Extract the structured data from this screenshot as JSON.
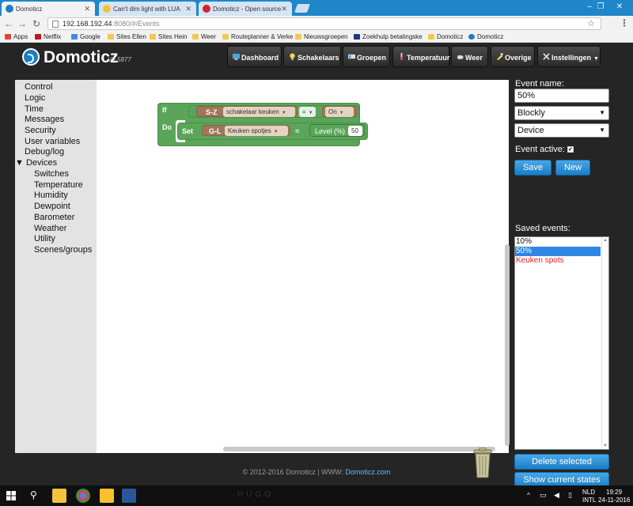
{
  "browser": {
    "tabs": [
      {
        "title": "Domoticz",
        "active": true
      },
      {
        "title": "Can't dim light with LUA",
        "active": false
      },
      {
        "title": "Domoticz - Open source",
        "active": false
      }
    ],
    "url_host": "192.168.192.44",
    "url_rest": ":8080/#/Events",
    "bookmarks": [
      "Apps",
      "Netflix",
      "Google",
      "Sites Ellen",
      "Sites Hein",
      "Weer",
      "Routeplanner & Verke",
      "Nieuwsgroepen",
      "Zoekhulp betalingske",
      "Domoticz",
      "Domoticz"
    ]
  },
  "app": {
    "name": "Domoticz",
    "version": "V3.5877",
    "nav": [
      "Dashboard",
      "Schakelaars",
      "Groepen",
      "Temperatuur",
      "Weer",
      "Overige",
      "Instellingen"
    ]
  },
  "sidebar": {
    "items": [
      "Control",
      "Logic",
      "Time",
      "Messages",
      "Security",
      "User variables",
      "Debug/log"
    ],
    "devices_toggle": "▼",
    "devices_label": "Devices",
    "subitems": [
      "Switches",
      "Temperature",
      "Humidity",
      "Dewpoint",
      "Barometer",
      "Weather",
      "Utility",
      "Scenes/groups"
    ]
  },
  "blocks": {
    "if_label": "If",
    "do_label": "Do",
    "cond_type": "S-Z",
    "cond_device": "schakelaar keuken",
    "cond_op": "=",
    "cond_value": "On",
    "set_label": "Set",
    "set_type": "G-L",
    "set_device": "Keuken spotjes",
    "set_eq": "=",
    "set_level_label": "Level (%)",
    "set_level_value": "50"
  },
  "panel": {
    "event_name_label": "Event name:",
    "event_name": "50%",
    "type_select": "Blockly",
    "trigger_select": "Device",
    "event_active_label": "Event active:",
    "event_active_check": "✔",
    "save": "Save",
    "new": "New",
    "saved_events_label": "Saved events:",
    "saved_events": [
      {
        "name": "10%",
        "selected": false,
        "active": true
      },
      {
        "name": "50%",
        "selected": true,
        "active": true
      },
      {
        "name": "Keuken spots",
        "selected": false,
        "active": false
      }
    ],
    "delete_selected": "Delete selected",
    "show_states": "Show current states"
  },
  "footer": {
    "copyright": "© 2012-2016 Domoticz | WWW: ",
    "link": "Domoticz.com"
  },
  "taskbar": {
    "lang_top": "NLD",
    "lang_bottom": "INTL",
    "time": "19:29",
    "date": "24-11-2016",
    "wallpaper_text": "HUGO"
  },
  "colors": {
    "accent": "#1b7ec2",
    "block_green": "#5ba55b",
    "block_brown": "#a0765a",
    "selected": "#2f86e4",
    "inactive_event": "#e02020"
  }
}
